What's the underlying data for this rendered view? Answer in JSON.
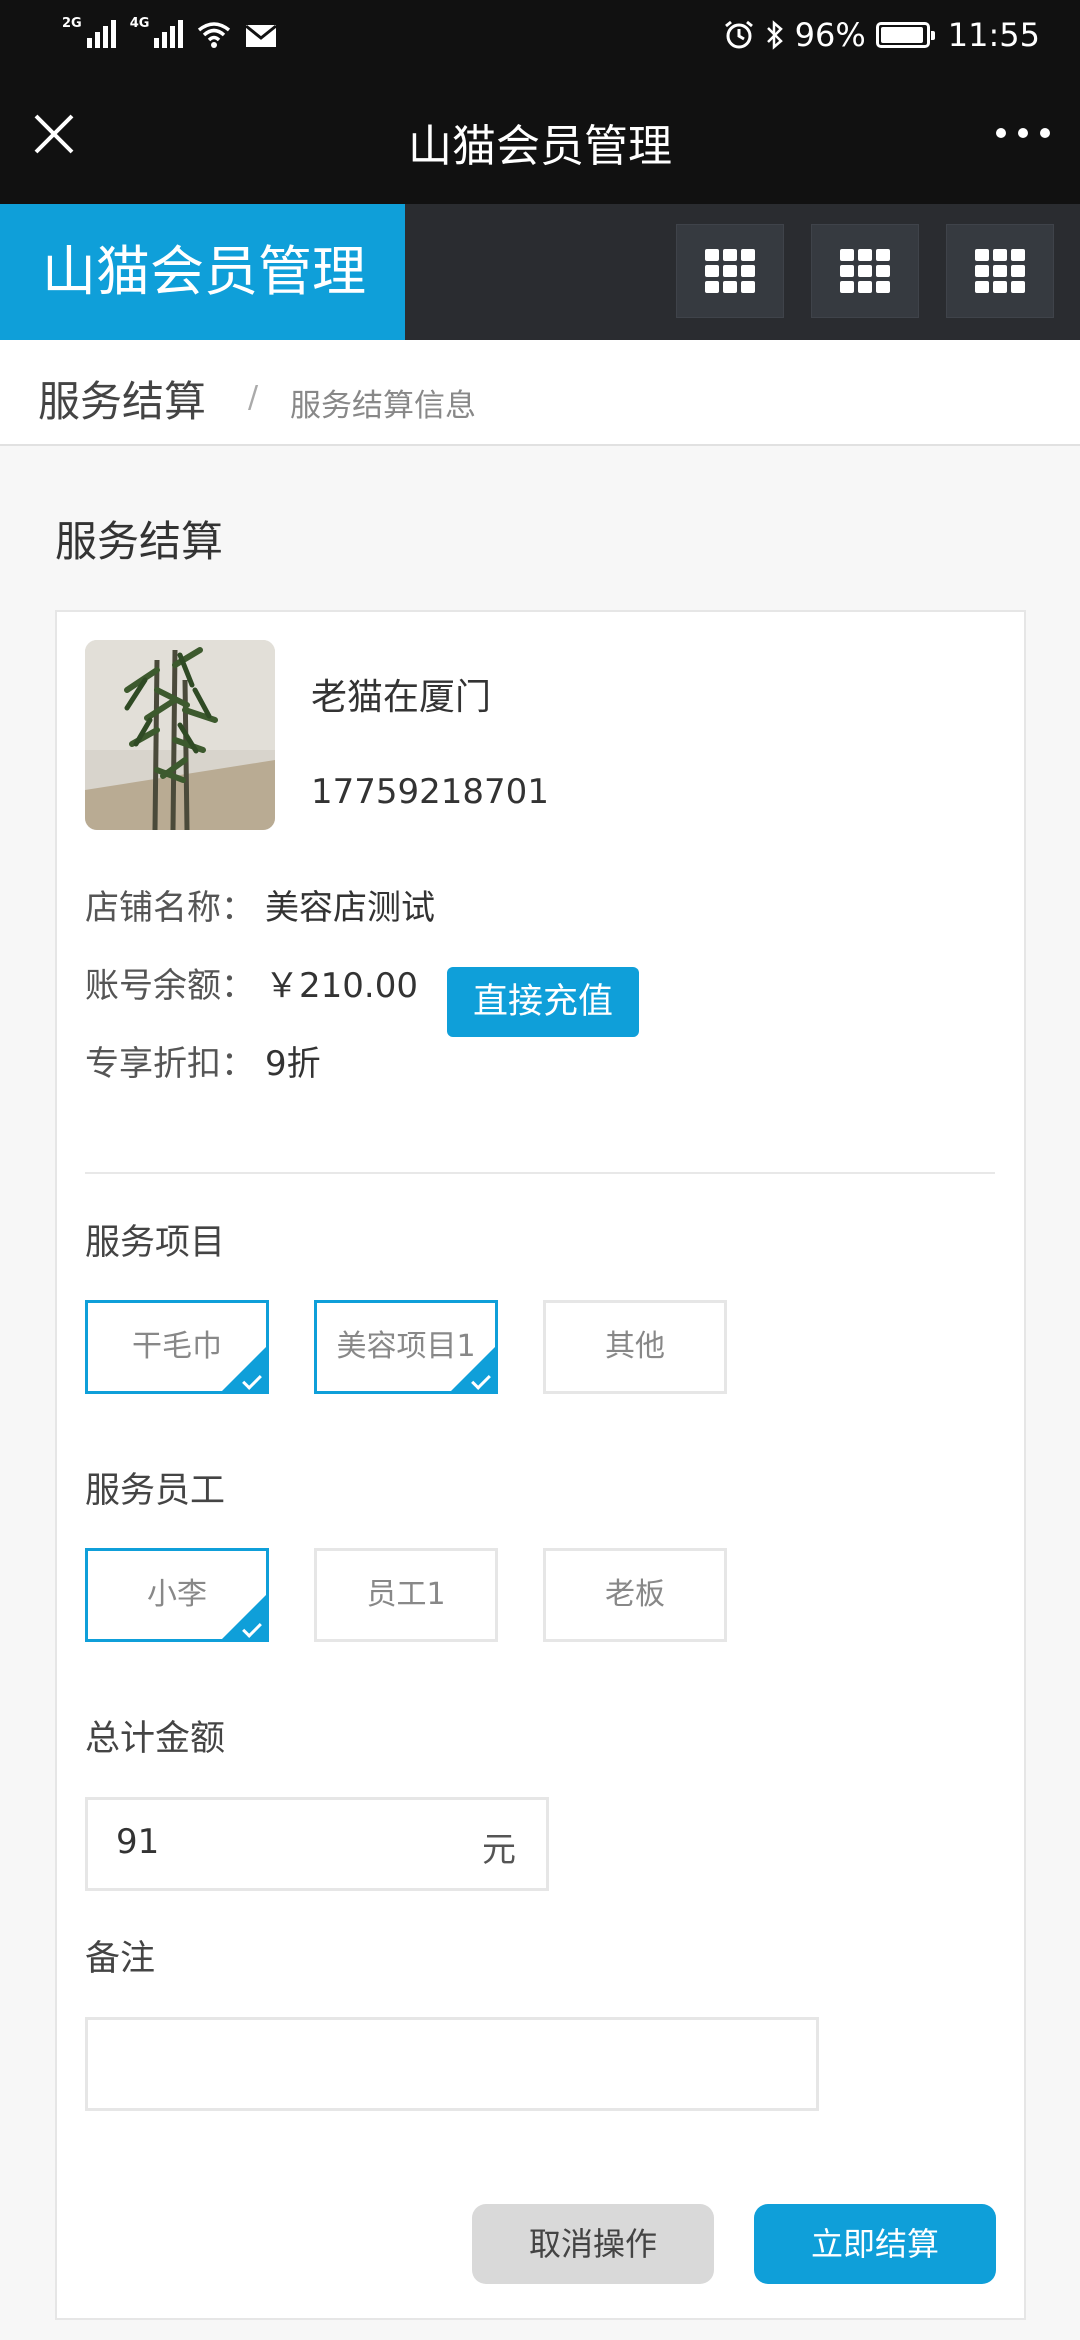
{
  "status_bar": {
    "sim1": "2G",
    "sim2": "4G",
    "battery_text": "96%",
    "battery_level": 0.96,
    "time": "11:55",
    "icons": [
      "signal-icon",
      "wifi-icon",
      "mail-icon",
      "alarm-icon",
      "bluetooth-icon",
      "battery-icon"
    ]
  },
  "titlebar": {
    "title": "山猫会员管理"
  },
  "app_header": {
    "brand": "山猫会员管理",
    "accent_color": "#0f9fd9",
    "menu_buttons": [
      "grid-icon",
      "grid-icon",
      "grid-icon"
    ]
  },
  "breadcrumb": {
    "current": "服务结算",
    "separator": "/",
    "sub": "服务结算信息"
  },
  "section_title": "服务结算",
  "member": {
    "name": "老猫在厦门",
    "phone": "17759218701",
    "store_label": "店铺名称：",
    "store_value": "美容店测试",
    "balance_label": "账号余额：",
    "balance_value": "￥210.00",
    "recharge_button": "直接充值",
    "discount_label": "专享折扣：",
    "discount_value": "9折"
  },
  "services": {
    "label": "服务项目",
    "options": [
      {
        "text": "干毛巾",
        "selected": true
      },
      {
        "text": "美容项目1",
        "selected": true
      },
      {
        "text": "其他",
        "selected": false
      }
    ]
  },
  "staff": {
    "label": "服务员工",
    "options": [
      {
        "text": "小李",
        "selected": true
      },
      {
        "text": "员工1",
        "selected": false
      },
      {
        "text": "老板",
        "selected": false
      }
    ]
  },
  "total": {
    "label": "总计金额",
    "value": "91",
    "unit": "元"
  },
  "remark": {
    "label": "备注",
    "value": ""
  },
  "actions": {
    "cancel": "取消操作",
    "submit": "立即结算"
  }
}
